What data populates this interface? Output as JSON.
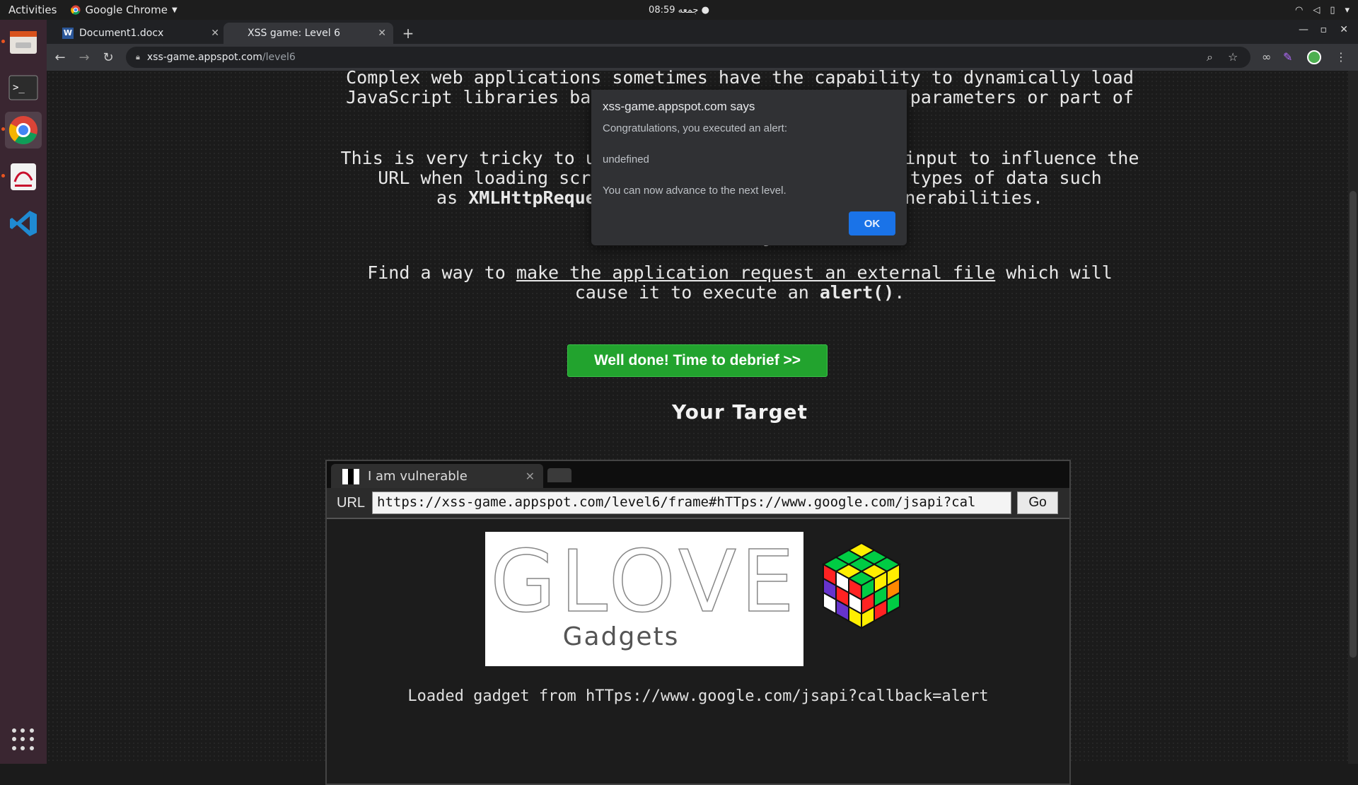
{
  "topbar": {
    "activities": "Activities",
    "app_name": "Google Chrome",
    "clock": "08:59 جمعه ●"
  },
  "dock": {
    "items": [
      "files-icon",
      "terminal-icon",
      "chrome-icon",
      "document-viewer-icon",
      "vscode-icon"
    ]
  },
  "browser": {
    "tabs": [
      {
        "label": "Document1.docx"
      },
      {
        "label": "XSS game: Level 6"
      }
    ],
    "url_host": "xss-game.appspot.com",
    "url_path": "/level6"
  },
  "page": {
    "intro_line1": "Complex web applications sometimes have the capability to dynamically load",
    "intro_line2": "JavaScript libraries based on the value of their URL parameters or part of",
    "tricky_line1": "This is very tricky to use properly -- allowing user input to influence the",
    "tricky_line2": "URL when loading scripts or potentially dangerous types of data such",
    "tricky_line3_pre": "as ",
    "tricky_line3_bold": "XMLHttpRequest",
    "tricky_line3_post": " often leads to serious vulnerabilities.",
    "mission_heading": "Mission Objective",
    "mission_pre": "Find a way to ",
    "mission_link": "make the application request an external file",
    "mission_post": " which will",
    "mission_line2_pre": "cause it to execute an ",
    "mission_line2_bold": "alert()",
    "mission_line2_post": ".",
    "debrief_button": "Well done! Time to debrief >>",
    "target_heading": "Your Target"
  },
  "frame": {
    "tab_label": "I am vulnerable",
    "url_label": "URL",
    "url_value": "https://xss-game.appspot.com/level6/frame#hTTps://www.google.com/jsapi?cal",
    "go_label": "Go",
    "logo_text_main": "GLOVE",
    "logo_text_sub": "Gadgets",
    "loaded_text": "Loaded gadget from hTTps://www.google.com/jsapi?callback=alert"
  },
  "alert": {
    "origin": "xss-game.appspot.com says",
    "message1": "Congratulations, you executed an alert:",
    "message2": "undefined",
    "message3": "You can now advance to the next level.",
    "ok_label": "OK"
  },
  "colors": {
    "accent_green": "#22a32e",
    "alert_button": "#1a73e8",
    "dock_bg": "#3a2631"
  }
}
